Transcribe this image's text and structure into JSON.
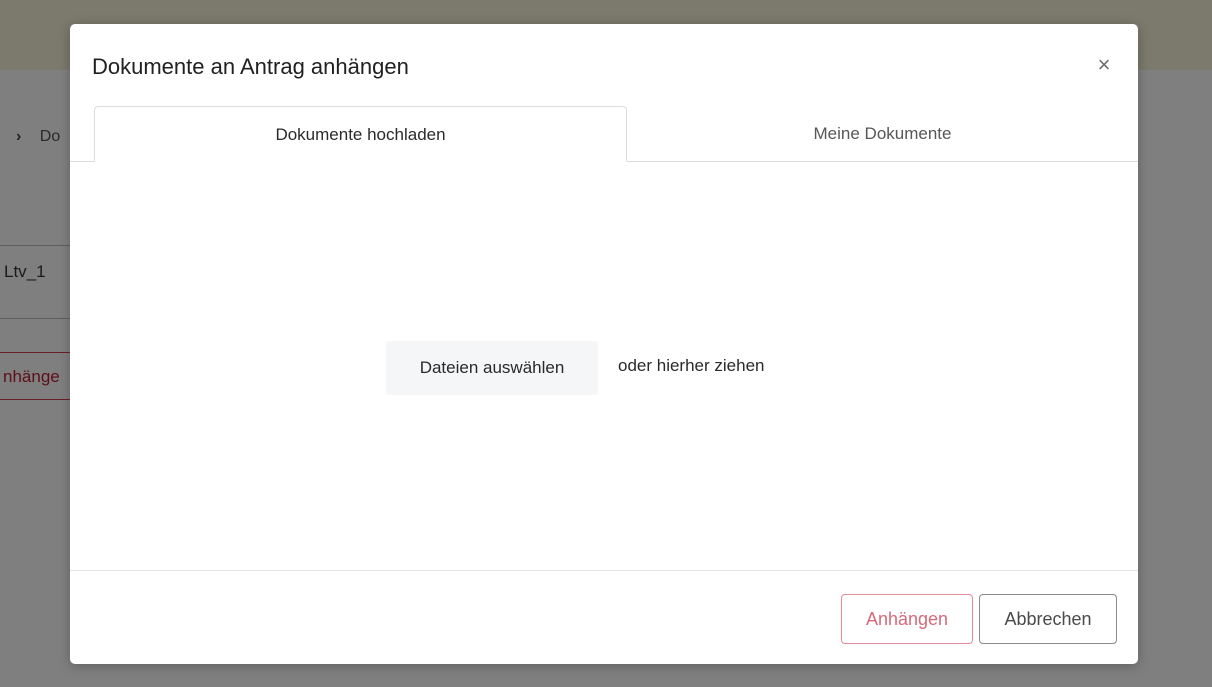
{
  "background": {
    "breadcrumb_chevron": "›",
    "breadcrumb_partial": "Do",
    "table_cell_partial": "Ltv_1",
    "button_partial": "nhänge"
  },
  "modal": {
    "title": "Dokumente an Antrag anhängen",
    "close_label": "×",
    "tabs": [
      {
        "label": "Dokumente hochladen",
        "active": true
      },
      {
        "label": "Meine Dokumente",
        "active": false
      }
    ],
    "dropzone": {
      "select_button_label": "Dateien auswählen",
      "drag_hint": "oder hierher ziehen"
    },
    "footer": {
      "attach_label": "Anhängen",
      "cancel_label": "Abbrechen"
    }
  },
  "colors": {
    "attach_button_border": "#e58b98",
    "attach_button_text": "#d56a7a",
    "overlay": "#7f7f7f"
  }
}
